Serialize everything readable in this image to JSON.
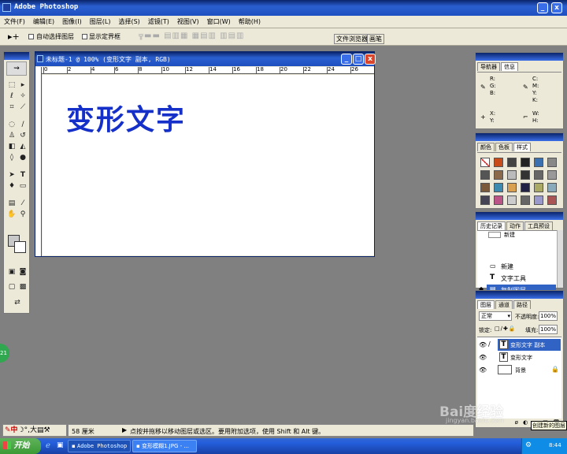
{
  "app": {
    "title": "Adobe Photoshop"
  },
  "menu": [
    "文件(F)",
    "编辑(E)",
    "图像(I)",
    "图层(L)",
    "选择(S)",
    "滤镜(T)",
    "视图(V)",
    "窗口(W)",
    "帮助(H)"
  ],
  "options": {
    "auto_select": "自动选择图层",
    "show_bounds": "显示定界框"
  },
  "palette_tabs": [
    "文件浏览器",
    "画笔"
  ],
  "document": {
    "title": "未标题-1 @ 100% (变形文字 副本, RGB)",
    "text": "变形文字",
    "ruler_labels": [
      "0",
      "2",
      "4",
      "6",
      "8",
      "10",
      "12",
      "14",
      "16",
      "18",
      "20",
      "22",
      "24",
      "26"
    ]
  },
  "navigator": {
    "tabs": [
      "导航器",
      "信息"
    ],
    "rgb": "R:\nG:\nB:",
    "cmyk": "C:\nM:\nY:\nK:",
    "xy": "X:\nY:",
    "wh": "W:\nH:"
  },
  "swatches_panel": {
    "tabs": [
      "颜色",
      "色板",
      "样式"
    ]
  },
  "history": {
    "tabs": [
      "历史记录",
      "动作",
      "工具预设"
    ],
    "top_item": "新建",
    "items": [
      "新建",
      "文字工具",
      "复制图层"
    ]
  },
  "layers": {
    "tabs": [
      "图层",
      "通道",
      "路径"
    ],
    "mode": "正常",
    "opacity_label": "不透明度:",
    "opacity": "100%",
    "lock_label": "锁定:",
    "fill_label": "填充:",
    "fill": "100%",
    "items": [
      "变形文字 副本",
      "变形文字",
      "背景"
    ],
    "tooltip": "创建新的图层"
  },
  "status": {
    "zoom": "58 厘米",
    "message": "点按并拖移以移动图层或选区。要用附加选项，使用 Shift 和 Alt 键。"
  },
  "ime": {
    "label": "中",
    "extra": "大"
  },
  "badge": "21",
  "taskbar": {
    "start": "开始",
    "items": [
      "Adobe Photoshop",
      "变形模糊1.JPG - ..."
    ],
    "clock": "8:44"
  },
  "watermark": {
    "brand": "Bai度经验",
    "url": "jingyan.baidu.com"
  }
}
